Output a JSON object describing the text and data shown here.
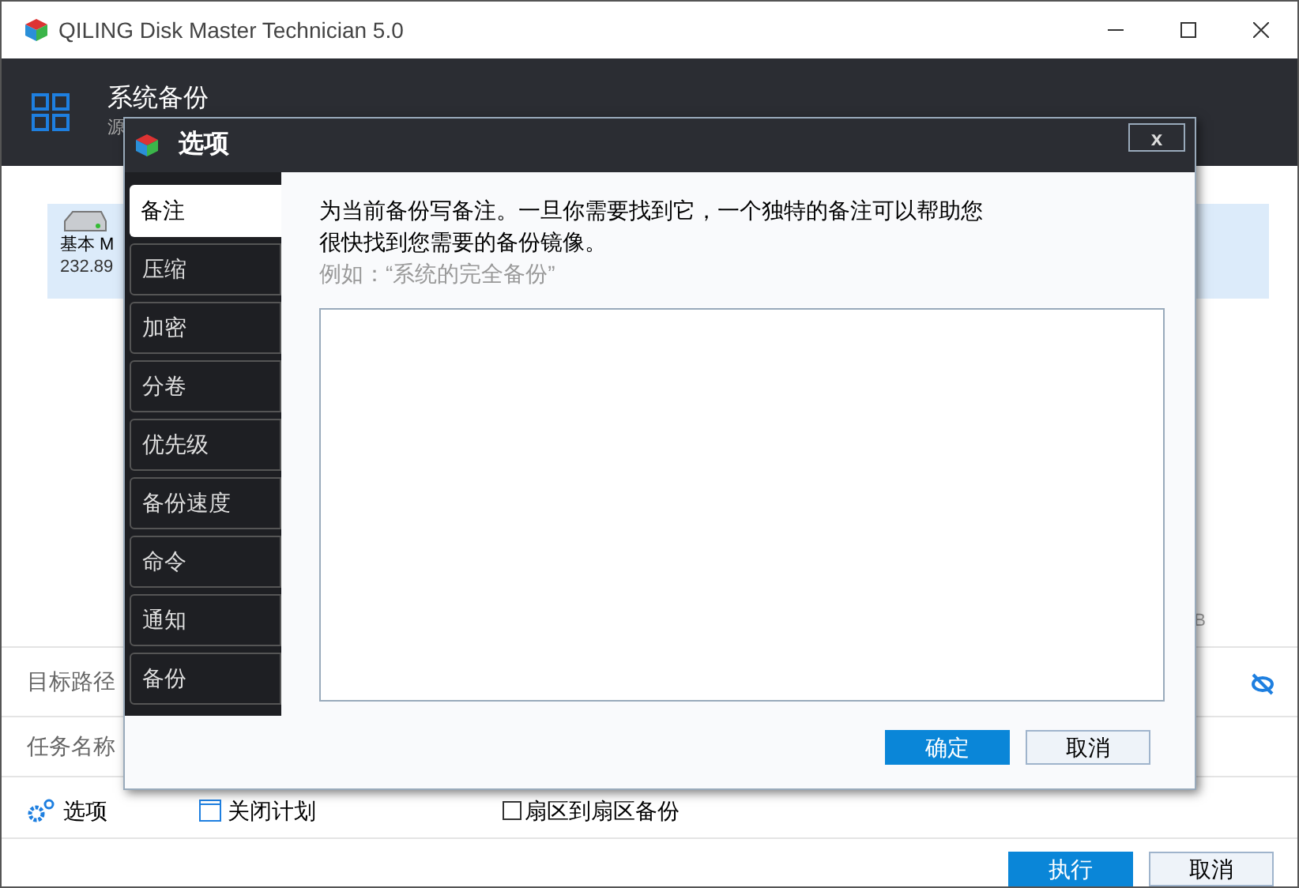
{
  "window": {
    "title": "QILING Disk Master Technician 5.0"
  },
  "header": {
    "title": "系统备份",
    "subtitle": "源"
  },
  "disk": {
    "name": "基本 M",
    "size": "232.89",
    "selected": true
  },
  "size_suffix": "B",
  "rows": [
    {
      "label": "目标路径"
    },
    {
      "label": "任务名称"
    }
  ],
  "options_row": {
    "options": "选项",
    "schedule": "关闭计划",
    "sector": {
      "label": "扇区到扇区备份",
      "checked": false
    }
  },
  "buttons": [
    {
      "label": "执行",
      "kind": "primary"
    },
    {
      "label": "取消",
      "kind": "secondary"
    }
  ],
  "dialog": {
    "title": "选项",
    "close": "x",
    "nav": [
      {
        "label": "备注",
        "selected": true
      },
      {
        "label": "压缩",
        "selected": false
      },
      {
        "label": "加密",
        "selected": false
      },
      {
        "label": "分卷",
        "selected": false
      },
      {
        "label": "优先级",
        "selected": false
      },
      {
        "label": "备份速度",
        "selected": false
      },
      {
        "label": "命令",
        "selected": false
      },
      {
        "label": "通知",
        "selected": false
      },
      {
        "label": "备份",
        "selected": false
      }
    ],
    "description": "为当前备份写备注。一旦你需要找到它，一个独特的备注可以帮助您很快找到您需要的备份镜像。",
    "example": "例如：“系统的完全备份”",
    "buttons": [
      {
        "label": "确定",
        "kind": "primary"
      },
      {
        "label": "取消",
        "kind": "secondary"
      }
    ]
  }
}
